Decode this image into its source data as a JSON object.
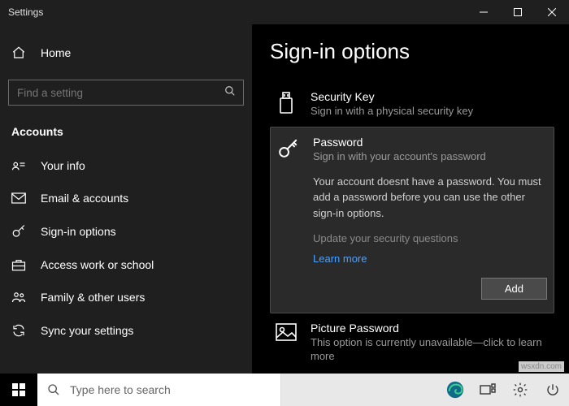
{
  "window": {
    "title": "Settings"
  },
  "sidebar": {
    "home": "Home",
    "search_placeholder": "Find a setting",
    "section": "Accounts",
    "items": [
      {
        "label": "Your info"
      },
      {
        "label": "Email & accounts"
      },
      {
        "label": "Sign-in options"
      },
      {
        "label": "Access work or school"
      },
      {
        "label": "Family & other users"
      },
      {
        "label": "Sync your settings"
      }
    ]
  },
  "content": {
    "heading": "Sign-in options",
    "security_key": {
      "title": "Security Key",
      "sub": "Sign in with a physical security key"
    },
    "password": {
      "title": "Password",
      "sub": "Sign in with your account's password",
      "detail": "Your account doesnt have a password. You must add a password before you can use the other sign-in options.",
      "questions": "Update your security questions",
      "learn": "Learn more",
      "add": "Add"
    },
    "picture": {
      "title": "Picture Password",
      "sub": "This option is currently unavailable—click to learn more"
    }
  },
  "taskbar": {
    "search_placeholder": "Type here to search"
  },
  "watermark": "wsxdn.com"
}
